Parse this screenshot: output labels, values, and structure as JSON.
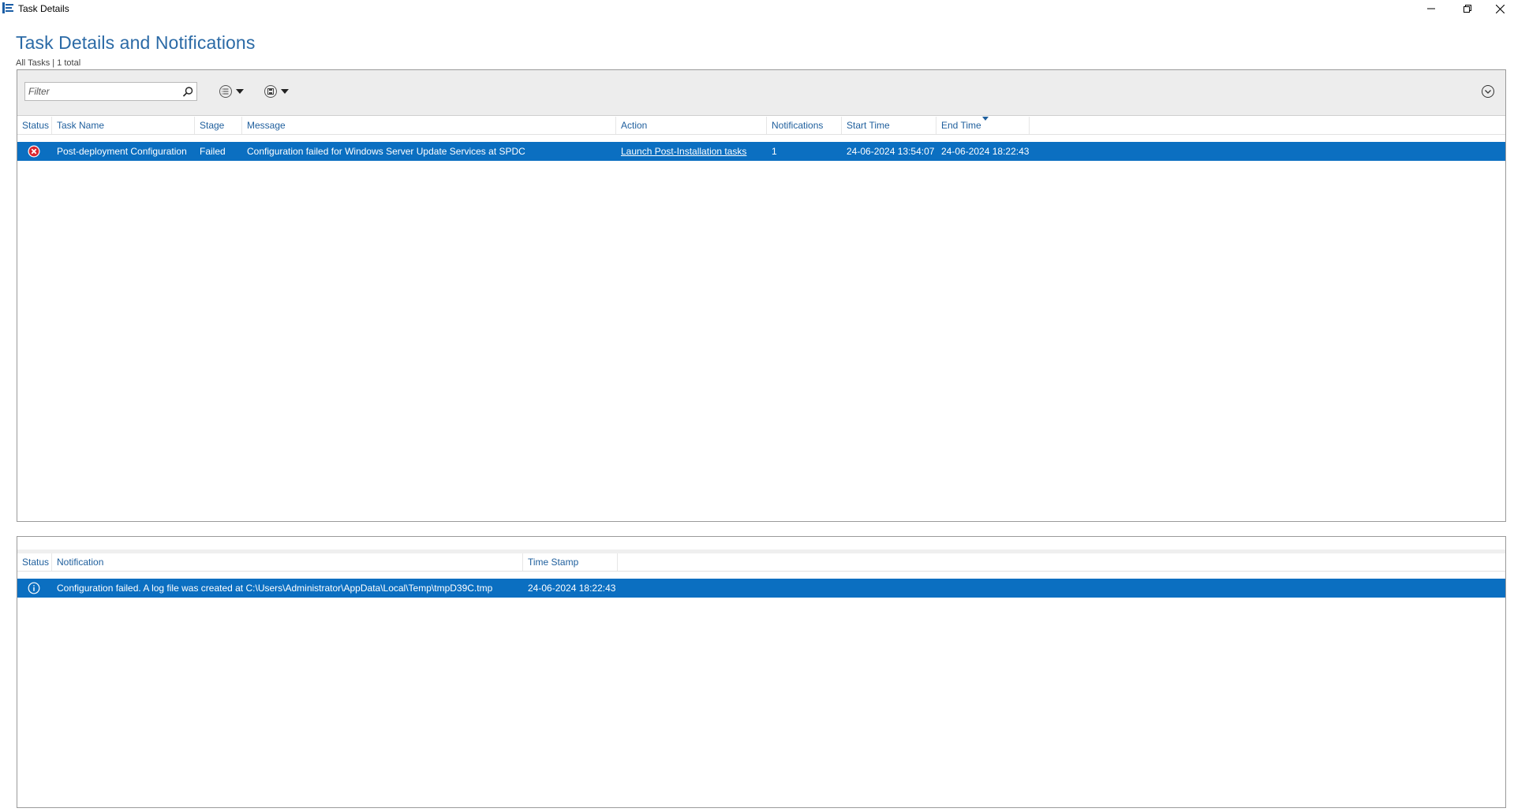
{
  "window": {
    "title": "Task Details"
  },
  "page": {
    "title": "Task Details and Notifications",
    "subtitle": "All Tasks | 1 total"
  },
  "toolbar": {
    "filter_placeholder": "Filter"
  },
  "tasks": {
    "columns": [
      "Status",
      "Task Name",
      "Stage",
      "Message",
      "Action",
      "Notifications",
      "Start Time",
      "End Time"
    ],
    "rows": [
      {
        "status_icon": "error-icon",
        "task_name": "Post-deployment Configuration",
        "stage": "Failed",
        "message": "Configuration failed for Windows Server Update Services at SPDC",
        "action": "Launch Post-Installation tasks",
        "notifications": "1",
        "start_time": "24-06-2024 13:54:07",
        "end_time": "24-06-2024 18:22:43"
      }
    ]
  },
  "notifications": {
    "columns": [
      "Status",
      "Notification",
      "Time Stamp"
    ],
    "rows": [
      {
        "status_icon": "info-icon",
        "notification": "Configuration failed. A log file was created at C:\\Users\\Administrator\\AppData\\Local\\Temp\\tmpD39C.tmp",
        "time_stamp": "24-06-2024 18:22:43"
      }
    ]
  },
  "colors": {
    "accent": "#2b6aa6",
    "selection": "#0b6fc1",
    "header_text": "#1f5f9d",
    "error": "#d8262f"
  }
}
